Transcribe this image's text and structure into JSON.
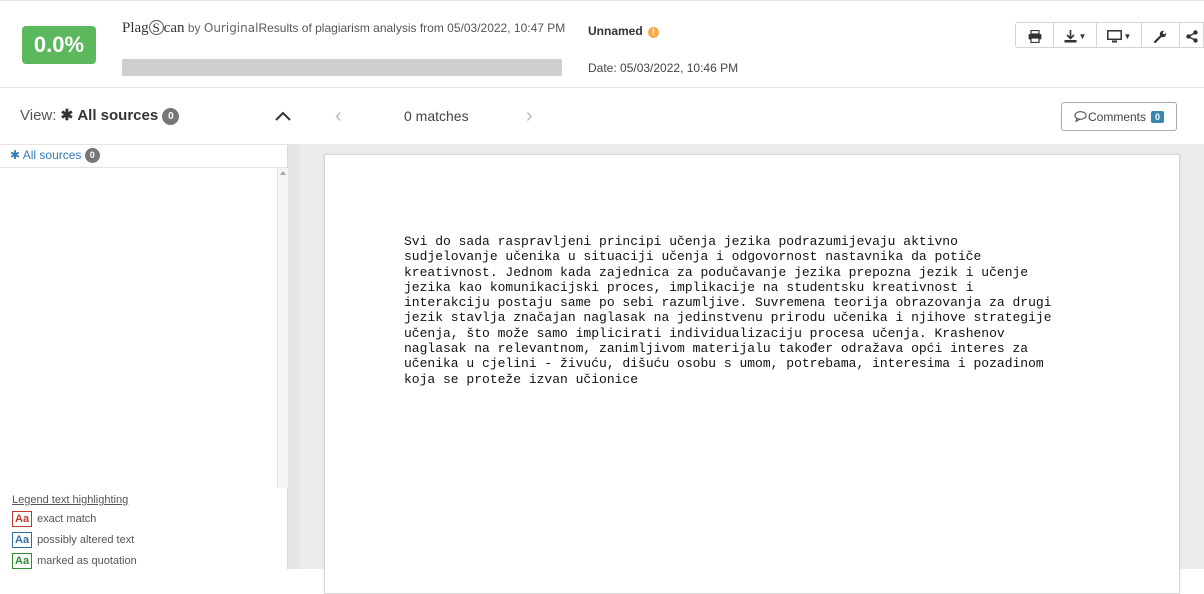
{
  "header": {
    "score": "0.0%",
    "score_percent": 0,
    "brand_plag": "Plag",
    "brand_s": "S",
    "brand_can": "can",
    "brand_by": "by",
    "brand_ouriginal": "Ouriginal",
    "results_text": "Results of plagiarism analysis from 05/03/2022, 10:47 PM",
    "doc_name": "Unnamed",
    "doc_date": "Date: 05/03/2022, 10:46 PM",
    "colors": {
      "score_badge": "#5cb85c",
      "info": "#f0ad4e"
    }
  },
  "toolbar": {
    "buttons": [
      {
        "name": "print-icon"
      },
      {
        "name": "download-icon"
      },
      {
        "name": "monitor-icon"
      },
      {
        "name": "wrench-icon"
      },
      {
        "name": "share-icon"
      }
    ]
  },
  "viewbar": {
    "view_prefix": "View:",
    "view_value": "All sources",
    "view_count": "0",
    "prev_arrow": "‹",
    "matches": "0 matches",
    "next_arrow": "›",
    "comments_label": "Comments",
    "comments_count": "0"
  },
  "sidebar": {
    "head_label": "All sources",
    "head_count": "0",
    "legend_title": "Legend text highlighting",
    "legend": [
      {
        "sample": "Aa",
        "label": "exact match",
        "color": "#c0392b"
      },
      {
        "sample": "Aa",
        "label": "possibly altered text",
        "color": "#2f6fa8"
      },
      {
        "sample": "Aa",
        "label": "marked as quotation",
        "color": "#2e8b2e"
      }
    ]
  },
  "document": {
    "lines": [
      "Svi do sada raspravljeni principi učenja jezika podrazumijevaju aktivno",
      "sudjelovanje učenika u situaciji učenja i odgovornost nastavnika da potiče",
      "kreativnost. Jednom kada zajednica za podučavanje jezika prepozna jezik i učenje",
      "jezika kao komunikacijski proces, implikacije na studentsku kreativnost i",
      "interakciju postaju same po sebi razumljive. Suvremena teorija obrazovanja za drugi",
      "jezik stavlja značajan naglasak na jedinstvenu prirodu učenika i njihove strategije",
      "učenja, što može samo implicirati individualizaciju procesa učenja. Krashenov",
      "naglasak na relevantnom, zanimljivom materijalu također odražava opći interes za",
      "učenika u cjelini - živuću, dišuću osobu s umom, potrebama, interesima i pozadinom",
      "koja se proteže izvan učionice"
    ]
  }
}
